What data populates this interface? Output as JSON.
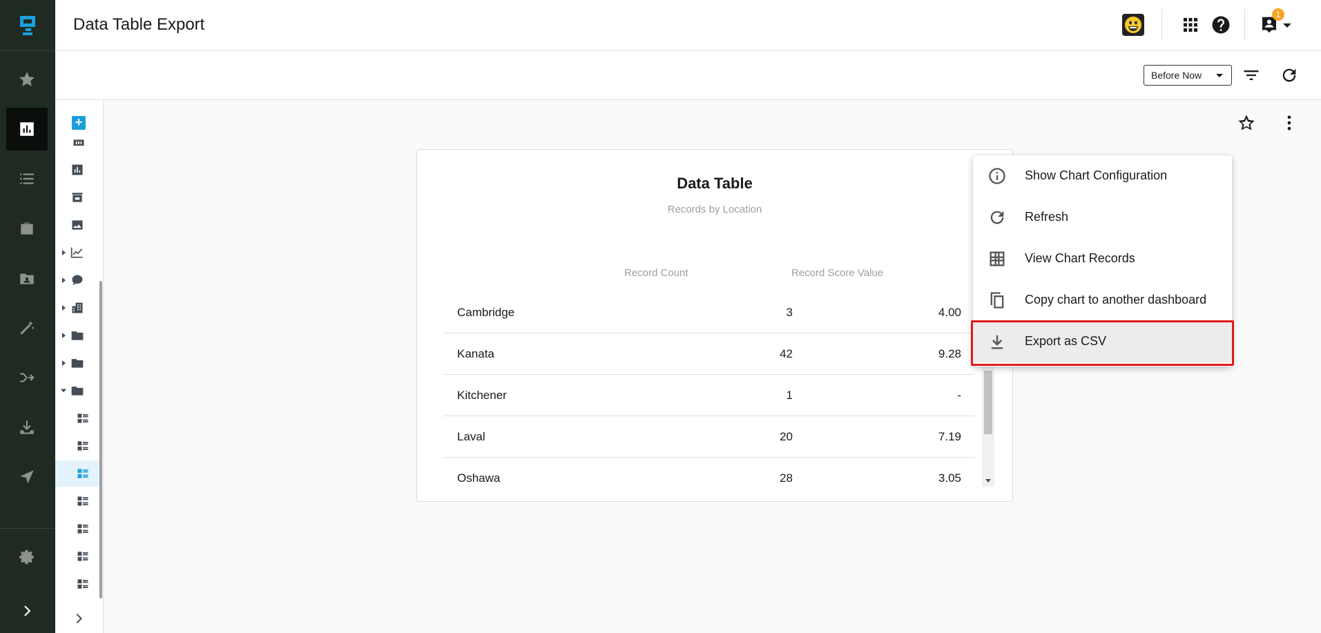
{
  "header": {
    "title": "Data Table Export",
    "notification_count": "1"
  },
  "toolbar": {
    "time_range": "Before Now"
  },
  "chart": {
    "title": "Data Table",
    "subtitle": "Records by Location",
    "columns": [
      "Record Count",
      "Record Score Value"
    ],
    "rows": [
      {
        "location": "Cambridge",
        "count": "3",
        "score": "4.00"
      },
      {
        "location": "Kanata",
        "count": "42",
        "score": "9.28"
      },
      {
        "location": "Kitchener",
        "count": "1",
        "score": "-"
      },
      {
        "location": "Laval",
        "count": "20",
        "score": "7.19"
      },
      {
        "location": "Oshawa",
        "count": "28",
        "score": "3.05"
      }
    ]
  },
  "menu": {
    "items": [
      {
        "label": "Show Chart Configuration",
        "icon": "info-icon"
      },
      {
        "label": "Refresh",
        "icon": "refresh-icon"
      },
      {
        "label": "View Chart Records",
        "icon": "grid-icon"
      },
      {
        "label": "Copy chart to another dashboard",
        "icon": "copy-icon"
      },
      {
        "label": "Export as CSV",
        "icon": "download-icon"
      }
    ],
    "highlighted": "Export as CSV"
  },
  "colors": {
    "rail_bg": "#1f2a23",
    "accent": "#1aa0dc",
    "highlight_border": "#e1191d",
    "badge": "#f5a623"
  }
}
